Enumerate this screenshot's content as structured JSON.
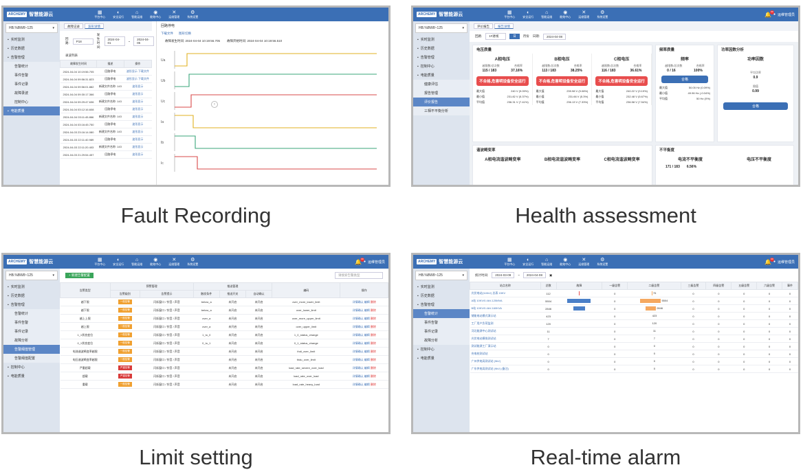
{
  "common": {
    "logo_box": "ARCHEMY",
    "logo_name": "智慧能源云",
    "nav": [
      {
        "icon": "▦",
        "label": "平台中心"
      },
      {
        "icon": "◐",
        "label": "安全运行"
      },
      {
        "icon": "⌂",
        "label": "智能运维"
      },
      {
        "icon": "◉",
        "label": "能效中心"
      },
      {
        "icon": "✕",
        "label": "运维管理"
      },
      {
        "icon": "⚙",
        "label": "系统设置"
      }
    ],
    "user": "运维管理员",
    "badge": "99",
    "site_selector": "HB.%BW8~125"
  },
  "captions": {
    "p1": "Fault Recording",
    "p2": "Health assessment",
    "p3": "Limit setting",
    "p4": "Real-time alarm"
  },
  "p1": {
    "side": [
      "实时监测",
      "历史数据",
      "告警管理",
      "告警统计",
      "事件告警",
      "事件记录",
      "故障录波",
      "控制中心",
      "电能质量"
    ],
    "tabs": [
      "故障记录",
      "波形详情"
    ],
    "filter": {
      "label1": "回路:",
      "val1": "P18",
      "label2": "发生时间:",
      "val2": "2024-04-01",
      "sep": "~",
      "val3": "2024-04-05"
    },
    "list_title": "录波列表",
    "headers": [
      "故障发生时间",
      "描述",
      "操作"
    ],
    "rows": [
      [
        "2024-04-04 10:19:56.705",
        "回路停电",
        "波形显示",
        "下载文件"
      ],
      [
        "2024-04-04 09:56:31.823",
        "回路停电",
        "波形显示",
        "下载文件"
      ],
      [
        "2024-04-04 09:56:01.882",
        "新建文件名称: 143",
        "波形显示",
        ""
      ],
      [
        "2024-04-04 09:30:17.366",
        "回路停电",
        "波形显示",
        ""
      ],
      [
        "2024-04-04 09:29:47.636",
        "新建文件名称: 143",
        "波形显示",
        ""
      ],
      [
        "2024-04-04 03:12:16.608",
        "回路停电",
        "波形显示",
        ""
      ],
      [
        "2024-04-04 03:11:45.866",
        "新建文件名称: 143",
        "波形显示",
        ""
      ],
      [
        "2024-04-04 03:16:45.750",
        "回路停电",
        "波形显示",
        ""
      ],
      [
        "2024-04-03 23:16:14.080",
        "新建文件名称: 143",
        "波形显示",
        ""
      ],
      [
        "2024-04-03 22:11:40.989",
        "回路停电",
        "波形显示",
        ""
      ],
      [
        "2024-04-03 22:11:20.403",
        "新建文件名称: 143",
        "波形显示",
        ""
      ],
      [
        "2024-04-03 21:29:54.457",
        "回路停电",
        "波形显示",
        ""
      ]
    ],
    "plot_title": "回路停电",
    "plot_tabs": [
      "下载文件",
      "图形切换"
    ],
    "plot_meta": [
      "故障发生时间: 2024-04-04 10:19:56.705",
      "故障开始时间: 2024-04-04 10:19:56.510"
    ],
    "traces": [
      {
        "color": "#e0b020",
        "label": "Ua"
      },
      {
        "color": "#3aa57a",
        "label": "Ub"
      },
      {
        "color": "#d94848",
        "label": "Uc"
      },
      {
        "color": "#e0b020",
        "label": "Ia"
      },
      {
        "color": "#3aa57a",
        "label": "Ib"
      },
      {
        "color": "#d94848",
        "label": "Ic"
      }
    ]
  },
  "p2": {
    "side": [
      "实时监测",
      "历史数据",
      "告警管理",
      "控制中心",
      "电能质量",
      "健康评估",
      "报告管理",
      "评价报告",
      "三相不平衡分析"
    ],
    "tabs": [
      "评价报告",
      "报告详情"
    ],
    "filter": {
      "label1": "回路:",
      "val1": "1#进线",
      "btn": "日",
      "label2": "月份",
      "label3": "日期:",
      "val3": "2024-04-08"
    },
    "sections": {
      "voltage": "电压质量",
      "freq": "频率质量",
      "pf": "功率因数分析",
      "thd": "谐波畸变率",
      "unb": "不平衡度"
    },
    "phases": [
      {
        "title": "A相电压",
        "h1": "越限数/总次数",
        "h2": "合格率",
        "v1": "115 / 183",
        "v2": "37.16%",
        "alarm": "不合格,危害明设备安全运行",
        "max": "240 V (9.09%)",
        "min": "231.82 V (5.37%)",
        "avg": "236.31 V (7.41%)"
      },
      {
        "title": "B相电压",
        "h1": "越限数/总次数",
        "h2": "合格率",
        "v1": "113 / 183",
        "v2": "38.25%",
        "alarm": "不合格,危害明设备安全运行",
        "max": "239.98 V (9.08%)",
        "min": "231.66 V (5.3%)",
        "avg": "236.13 V (7.33%)"
      },
      {
        "title": "C相电压",
        "h1": "越限数/总次数",
        "h2": "合格率",
        "v1": "116 / 183",
        "v2": "36.61%",
        "alarm": "不合格,危害明设备安全运行",
        "max": "240.22 V (9.19%)",
        "min": "232.48 V (5.67%)",
        "avg": "236.58 V (7.54%)"
      }
    ],
    "row_labels": [
      "最大值",
      "最小值",
      "平均值"
    ],
    "freq": {
      "title": "频率",
      "h1": "越限数/总次数",
      "h2": "合格率",
      "v1": "0 / 16",
      "v2": "100%",
      "ok": "合格",
      "max": "50.05 Hz (0.09%)",
      "min": "49.96 Hz (-0.04%)",
      "avg": "50 Hz (0%)"
    },
    "pf": {
      "title": "功率因数",
      "h1": "平均功率",
      "v1": "0.9",
      "h2": "限值",
      "v2": "0.99",
      "ok": "合格"
    },
    "thd_titles": [
      "A相电流谐波畸变率",
      "B相电流谐波畸变率",
      "C相电流谐波畸变率"
    ],
    "unb_titles": [
      "电流不平衡度",
      "电压不平衡度"
    ],
    "unb_vals": [
      "171 / 183",
      "6.56%"
    ]
  },
  "p3": {
    "side": [
      "实时监测",
      "历史数据",
      "告警管理",
      "告警统计",
      "事件告警",
      "事件记录",
      "故障分析",
      "告警阈值管理",
      "告警阈值配置",
      "控制中心",
      "电能质量"
    ],
    "add_btn": "+ 新建告警配置",
    "search": "请搜索告警类型",
    "groups": [
      "告警类型",
      "预警管理",
      "推送管理",
      "编码",
      "操作"
    ],
    "sub_headers": [
      "告警级别",
      "告警提示",
      "触发条件",
      "推送开关",
      "自动确认"
    ],
    "rows": [
      {
        "type": "越下限",
        "lvl": "warn",
        "lvlt": "一般告警",
        "hint": "闪烁窗口 / 铃音 / 声音",
        "cond": "below_a",
        "push": "未开启",
        "auto": "未开启",
        "code": "over_more_lower_limit"
      },
      {
        "type": "越下限",
        "lvl": "warn",
        "lvlt": "一般告警",
        "hint": "闪烁窗口 / 铃音 / 声音",
        "cond": "below_a",
        "push": "未开启",
        "auto": "未开启",
        "code": "over_lower_limit"
      },
      {
        "type": "越上上限",
        "lvl": "warn",
        "lvlt": "一般告警",
        "hint": "闪烁窗口 / 铃音 / 声音",
        "cond": "over_a",
        "push": "未开启",
        "auto": "未开启",
        "code": "over_more_upper_limit"
      },
      {
        "type": "越上限",
        "lvl": "warn",
        "lvlt": "一般告警",
        "hint": "闪烁窗口 / 铃音 / 声音",
        "cond": "over_a",
        "push": "未开启",
        "auto": "未开启",
        "code": "over_upper_limit"
      },
      {
        "type": "1_1状态变位",
        "lvl": "warn",
        "lvlt": "一般告警",
        "hint": "闪烁窗口 / 铃音 / 声音",
        "cond": "1_to_0",
        "push": "未开启",
        "auto": "未开启",
        "code": "1_0_status_change"
      },
      {
        "type": "0_1状态变位",
        "lvl": "warn",
        "lvlt": "一般告警",
        "hint": "闪烁窗口 / 铃音 / 声音",
        "cond": "0_to_1",
        "push": "未开启",
        "auto": "未开启",
        "code": "0_1_status_change"
      },
      {
        "type": "电流谐波畸变率越限",
        "lvl": "warn",
        "lvlt": "一般告警",
        "hint": "闪烁窗口 / 铃音 / 声音",
        "cond": "",
        "push": "未开启",
        "auto": "未开启",
        "code": "thdi_over_limit"
      },
      {
        "type": "电压谐波畸变率越限",
        "lvl": "warn",
        "lvlt": "一般告警",
        "hint": "闪烁窗口 / 铃音 / 声音",
        "cond": "",
        "push": "未开启",
        "auto": "未开启",
        "code": "thdu_over_limit"
      },
      {
        "type": "严重超载",
        "lvl": "crit",
        "lvlt": "严重告警",
        "hint": "闪烁窗口 / 铃音 / 声音",
        "cond": "",
        "push": "未开启",
        "auto": "未开启",
        "code": "load_rate_severe_over_load"
      },
      {
        "type": "超载",
        "lvl": "crit",
        "lvlt": "严重告警",
        "hint": "闪烁窗口 / 铃音 / 声音",
        "cond": "",
        "push": "未开启",
        "auto": "未开启",
        "code": "load_rate_over_load"
      },
      {
        "type": "重载",
        "lvl": "warn",
        "lvlt": "一般告警",
        "hint": "闪烁窗口 / 铃音 / 声音",
        "cond": "",
        "push": "未开启",
        "auto": "未开启",
        "code": "load_rate_heavy_load"
      }
    ],
    "actions": [
      "详情确认",
      "编辑",
      "删除"
    ]
  },
  "p4": {
    "side": [
      "实时监测",
      "历史数据",
      "告警管理",
      "告警统计",
      "事件告警",
      "事件记录",
      "故障分析",
      "控制中心",
      "电能质量"
    ],
    "filter": {
      "label": "统计时间:",
      "from": "2024-03-09",
      "sep": "~",
      "to": "2024-04-08"
    },
    "headers": [
      "站点名称",
      "总数",
      "故障",
      "一级告警",
      "二级告警",
      "三级告警",
      "四级告警",
      "五级告警",
      "六级告警",
      "事件"
    ],
    "max_total": 5504,
    "rows": [
      {
        "name": "光伏电站(110kV) 总表 15KV",
        "total": "112",
        "fault": 112,
        "faultc": "#e84d4d",
        "l1": "0",
        "l2": "76",
        "l2v": 76,
        "rest": [
          "0",
          "0",
          "0",
          "0",
          "0"
        ]
      },
      {
        "name": "A站 10KV/0.4kV-125MVA",
        "total": "5504",
        "fault": 5504,
        "faultc": "#4a7fc8",
        "l1": "0",
        "l2": "5504",
        "l2v": 5504,
        "rest": [
          "0",
          "0",
          "0",
          "0",
          "0"
        ]
      },
      {
        "name": "B站 10KV/0.4kV-160KVA",
        "total": "2846",
        "fault": 2846,
        "faultc": "#4a7fc8",
        "l1": "0",
        "l2": "2846",
        "l2v": 2846,
        "rest": [
          "0",
          "0",
          "0",
          "0",
          "0"
        ]
      },
      {
        "name": "储能电站模式演示站",
        "total": "423",
        "fault": 0,
        "faultc": "#4a7fc8",
        "l1": "0",
        "l2": "423",
        "l2v": 0,
        "rest": [
          "0",
          "0",
          "0",
          "0",
          "0"
        ]
      },
      {
        "name": "工厂用户负荷监测",
        "total": "120",
        "fault": 0,
        "faultc": "#4a7fc8",
        "l1": "0",
        "l2": "120",
        "l2v": 0,
        "rest": [
          "0",
          "0",
          "0",
          "0",
          "0"
        ]
      },
      {
        "name": "河北能源中心测试站",
        "total": "11",
        "fault": 0,
        "faultc": "#4a7fc8",
        "l1": "0",
        "l2": "11",
        "l2v": 0,
        "rest": [
          "0",
          "0",
          "0",
          "0",
          "0"
        ]
      },
      {
        "name": "光伏电站模拟测试站",
        "total": "7",
        "fault": 0,
        "faultc": "#4a7fc8",
        "l1": "0",
        "l2": "7",
        "l2v": 0,
        "rest": [
          "0",
          "0",
          "0",
          "0",
          "0"
        ]
      },
      {
        "name": "测试能源工厂演示站",
        "total": "0",
        "fault": 0,
        "faultc": "#4a7fc8",
        "l1": "0",
        "l2": "0",
        "l2v": 0,
        "rest": [
          "0",
          "0",
          "0",
          "0",
          "0"
        ]
      },
      {
        "name": "充电桩测试站",
        "total": "0",
        "fault": 0,
        "faultc": "#4a7fc8",
        "l1": "0",
        "l2": "0",
        "l2v": 0,
        "rest": [
          "0",
          "0",
          "0",
          "0",
          "0"
        ]
      },
      {
        "name": "广州供电局测试站 (9kV)",
        "total": "0",
        "fault": 0,
        "faultc": "#4a7fc8",
        "l1": "0",
        "l2": "0",
        "l2v": 0,
        "rest": [
          "0",
          "0",
          "0",
          "0",
          "0"
        ]
      },
      {
        "name": "广东供电局测试站 (9kV) (备注)",
        "total": "0",
        "fault": 0,
        "faultc": "#4a7fc8",
        "l1": "0",
        "l2": "0",
        "l2v": 0,
        "rest": [
          "0",
          "0",
          "0",
          "0",
          "0"
        ]
      }
    ]
  }
}
